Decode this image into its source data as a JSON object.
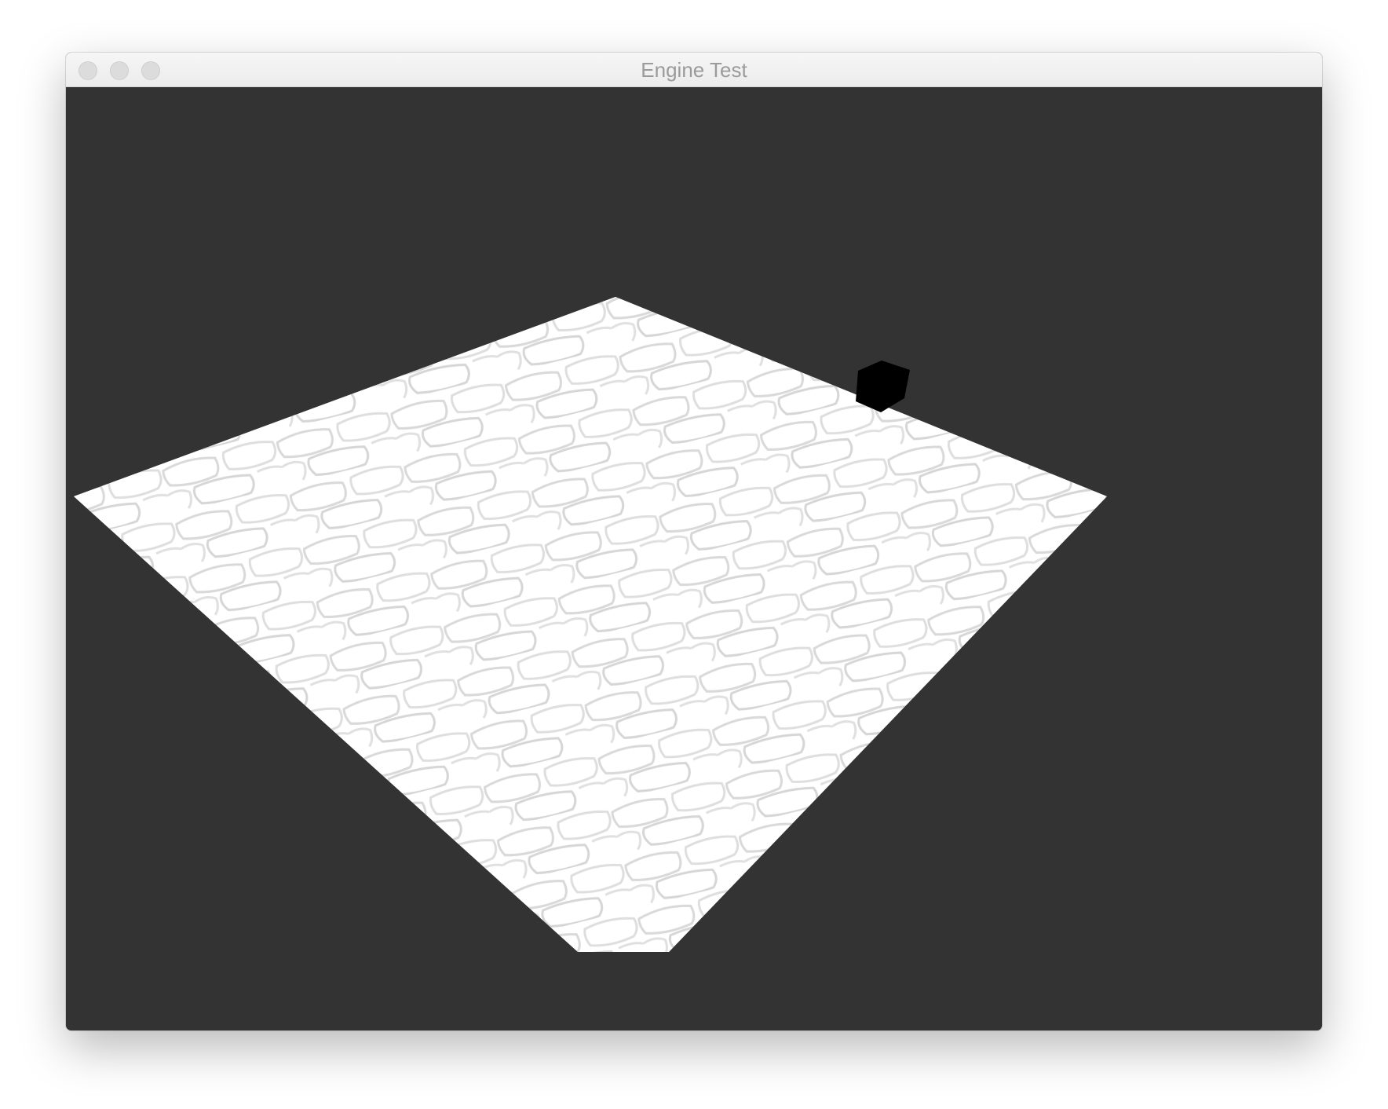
{
  "window": {
    "title": "Engine Test",
    "controls": [
      "close",
      "minimize",
      "zoom"
    ]
  },
  "viewport": {
    "background_color": "#333333",
    "scene": {
      "floor": {
        "color": "#ffffff",
        "texture": "cobblestone-normal-map"
      },
      "cube": {
        "color": "#000000"
      }
    }
  }
}
